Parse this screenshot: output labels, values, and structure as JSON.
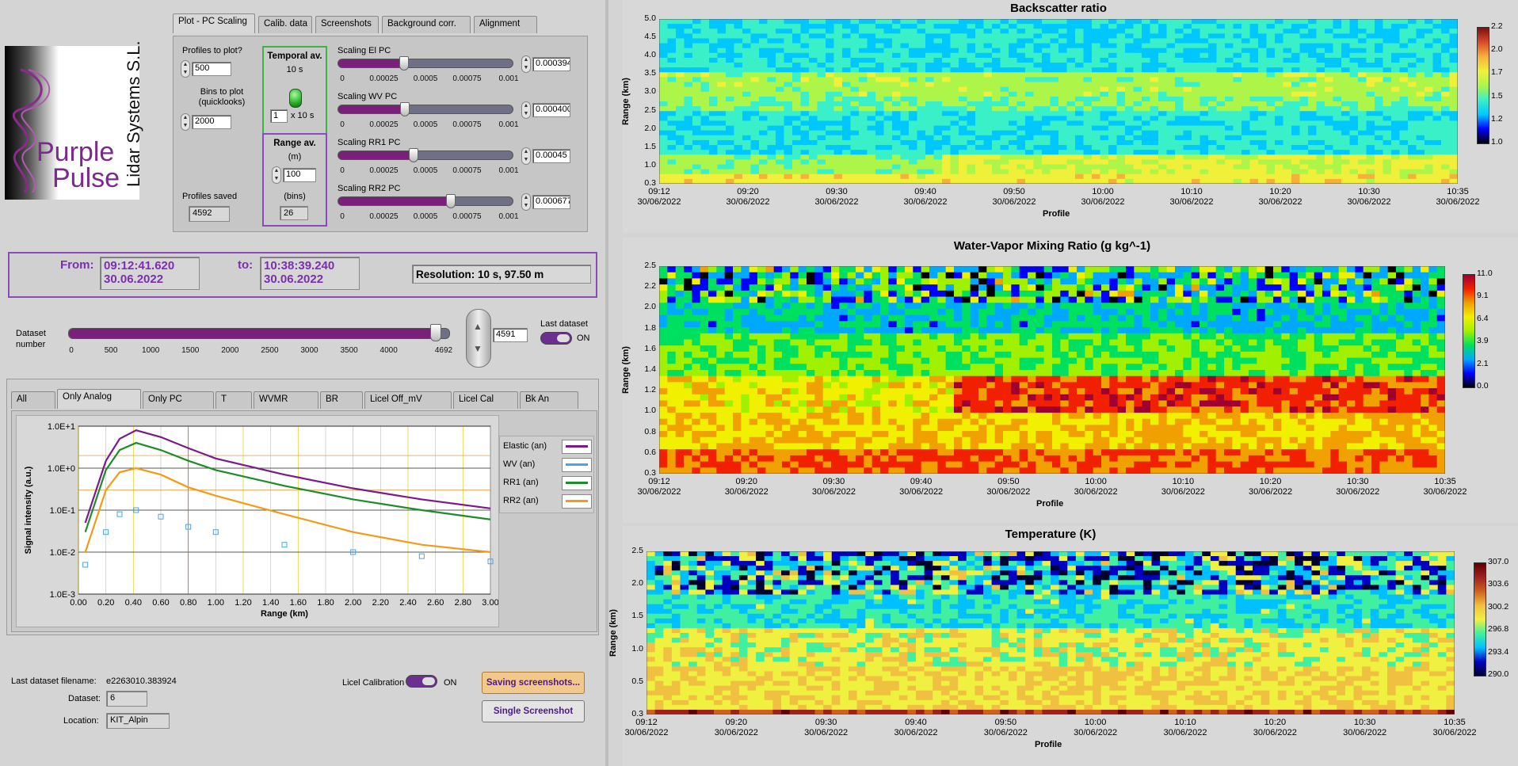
{
  "logo": {
    "line1": "Purple",
    "line2": "Pulse",
    "vertical_text": "Lidar Systems S.L."
  },
  "tabs_top": [
    "Plot - PC Scaling",
    "Calib. data",
    "Screenshots",
    "Background corr.",
    "Alignment"
  ],
  "controls": {
    "profiles_to_plot_label": "Profiles to plot?",
    "profiles_to_plot": "500",
    "bins_to_plot_label": "Bins to plot (quicklooks)",
    "bins_to_plot": "2000",
    "profiles_saved_label": "Profiles saved",
    "profiles_saved": "4592",
    "temporal_av_label": "Temporal av.",
    "temporal_av_value": "10 s",
    "temporal_av_factor": "1",
    "temporal_av_unit": "x 10 s",
    "range_av_label": "Range av.",
    "range_av_unit_m": "(m)",
    "range_av_m": "100",
    "range_av_unit_bins": "(bins)",
    "range_av_bins": "26"
  },
  "scaling": [
    {
      "label": "Scaling El PC",
      "value": "0.000394",
      "level": 0.394
    },
    {
      "label": "Scaling WV PC",
      "value": "0.000400",
      "level": 0.4
    },
    {
      "label": "Scaling RR1 PC",
      "value": "0.00045",
      "level": 0.45
    },
    {
      "label": "Scaling RR2 PC",
      "value": "0.000677",
      "level": 0.677
    }
  ],
  "scaling_ticks": [
    "0",
    "0.00025",
    "0.0005",
    "0.00075",
    "0.001"
  ],
  "time_range": {
    "from_label": "From:",
    "from_time": "09:12:41.620",
    "from_date": "30.06.2022",
    "to_label": "to:",
    "to_time": "10:38:39.240",
    "to_date": "30.06.2022",
    "resolution": "Resolution: 10 s, 97.50 m"
  },
  "dataset": {
    "label": "Dataset number",
    "ticks": [
      "0",
      "500",
      "1000",
      "1500",
      "2000",
      "2500",
      "3000",
      "3500",
      "4000",
      "4692"
    ],
    "max": 4692,
    "value": "4591",
    "position": 4591,
    "last_dataset_label": "Last dataset",
    "last_dataset_state": "ON"
  },
  "tabs_plot": [
    "All",
    "Only Analog",
    "Only PC",
    "T",
    "WVMR",
    "BR",
    "Licel Off_mV",
    "Licel Cal",
    "Bk An"
  ],
  "signal_plot": {
    "ylabel": "Signal intensity (a.u.)",
    "xlabel": "Range (km)",
    "yticks": [
      "1.0E+1",
      "1.0E+0",
      "1.0E-1",
      "1.0E-2",
      "1.0E-3"
    ],
    "xticks": [
      "0.00",
      "0.20",
      "0.40",
      "0.60",
      "0.80",
      "1.00",
      "1.20",
      "1.40",
      "1.60",
      "1.80",
      "2.00",
      "2.20",
      "2.40",
      "2.60",
      "2.80",
      "3.00"
    ],
    "legend": [
      {
        "name": "Elastic (an)",
        "color": "#7a1a8a"
      },
      {
        "name": "WV (an)",
        "color": "#4aa3e8"
      },
      {
        "name": "RR1 (an)",
        "color": "#1e8c2a"
      },
      {
        "name": "RR2 (an)",
        "color": "#f59a16"
      }
    ]
  },
  "chart_data": [
    {
      "type": "line",
      "title": "",
      "xlabel": "Range (km)",
      "ylabel": "Signal intensity (a.u.)",
      "y_scale": "log",
      "xlim": [
        0,
        3.0
      ],
      "ylim": [
        0.001,
        10
      ],
      "x": [
        0.05,
        0.2,
        0.3,
        0.42,
        0.6,
        0.8,
        1.0,
        1.5,
        2.0,
        2.5,
        3.0
      ],
      "series": [
        {
          "name": "Elastic (an)",
          "values": [
            0.05,
            1.5,
            5.0,
            8.0,
            5.5,
            3.0,
            1.7,
            0.7,
            0.33,
            0.18,
            0.11
          ]
        },
        {
          "name": "RR1 (an)",
          "values": [
            0.03,
            0.9,
            2.7,
            4.0,
            2.7,
            1.5,
            0.9,
            0.38,
            0.18,
            0.1,
            0.06
          ]
        },
        {
          "name": "RR2 (an)",
          "values": [
            0.01,
            0.3,
            0.8,
            1.0,
            0.7,
            0.35,
            0.22,
            0.08,
            0.03,
            0.015,
            0.01
          ]
        },
        {
          "name": "WV (an)",
          "values": [
            0.005,
            0.03,
            0.08,
            0.1,
            0.07,
            0.04,
            0.03,
            0.015,
            0.01,
            0.008,
            0.006
          ]
        }
      ]
    },
    {
      "type": "heatmap",
      "title": "Backscatter ratio",
      "xlabel": "Profile",
      "ylabel": "Range (km)",
      "ylim": [
        0.3,
        5.0
      ],
      "yticks": [
        "5.0",
        "4.5",
        "4.0",
        "3.5",
        "3.0",
        "2.5",
        "2.0",
        "1.5",
        "1.0",
        "0.3"
      ],
      "xticks": [
        "09:12",
        "09:20",
        "09:30",
        "09:40",
        "09:50",
        "10:00",
        "10:10",
        "10:20",
        "10:30",
        "10:35"
      ],
      "date": "30/06/2022",
      "colorbar": [
        "2.2",
        "2.0",
        "1.7",
        "1.5",
        "1.2",
        "1.0"
      ]
    },
    {
      "type": "heatmap",
      "title": "Water-Vapor Mixing Ratio  (g kg^-1)",
      "xlabel": "Profile",
      "ylabel": "Range (km)",
      "ylim": [
        0.3,
        2.5
      ],
      "yticks": [
        "2.5",
        "2.2",
        "2.0",
        "1.8",
        "1.6",
        "1.4",
        "1.2",
        "1.0",
        "0.8",
        "0.6",
        "0.3"
      ],
      "xticks": [
        "09:12",
        "09:20",
        "09:30",
        "09:40",
        "09:50",
        "10:00",
        "10:10",
        "10:20",
        "10:30",
        "10:35"
      ],
      "date": "30/06/2022",
      "colorbar": [
        "11.0",
        "9.1",
        "6.4",
        "3.9",
        "2.1",
        "0.0"
      ]
    },
    {
      "type": "heatmap",
      "title": "Temperature (K)",
      "xlabel": "Profile",
      "ylabel": "Range (km)",
      "ylim": [
        0.3,
        2.5
      ],
      "yticks": [
        "2.5",
        "2.0",
        "1.5",
        "1.0",
        "0.5",
        "0.3"
      ],
      "xticks": [
        "09:12",
        "09:20",
        "09:30",
        "09:40",
        "09:50",
        "10:00",
        "10:10",
        "10:20",
        "10:30",
        "10:35"
      ],
      "date": "30/06/2022",
      "colorbar": [
        "307.0",
        "303.6",
        "300.2",
        "296.8",
        "293.4",
        "290.0"
      ]
    }
  ],
  "bottom": {
    "filename_label": "Last dataset filename:",
    "filename": "e2263010.383924",
    "dataset_label": "Dataset:",
    "dataset": "6",
    "location_label": "Location:",
    "location": "KIT_Alpin",
    "licel_cal_label": "Licel Calibration",
    "licel_cal_state": "ON",
    "saving_btn": "Saving screenshots...",
    "single_btn": "Single Screenshot"
  },
  "colors": {
    "accent": "#7a1f7a",
    "purple_text": "#7b2fb0",
    "panel": "#cfcfcf"
  }
}
